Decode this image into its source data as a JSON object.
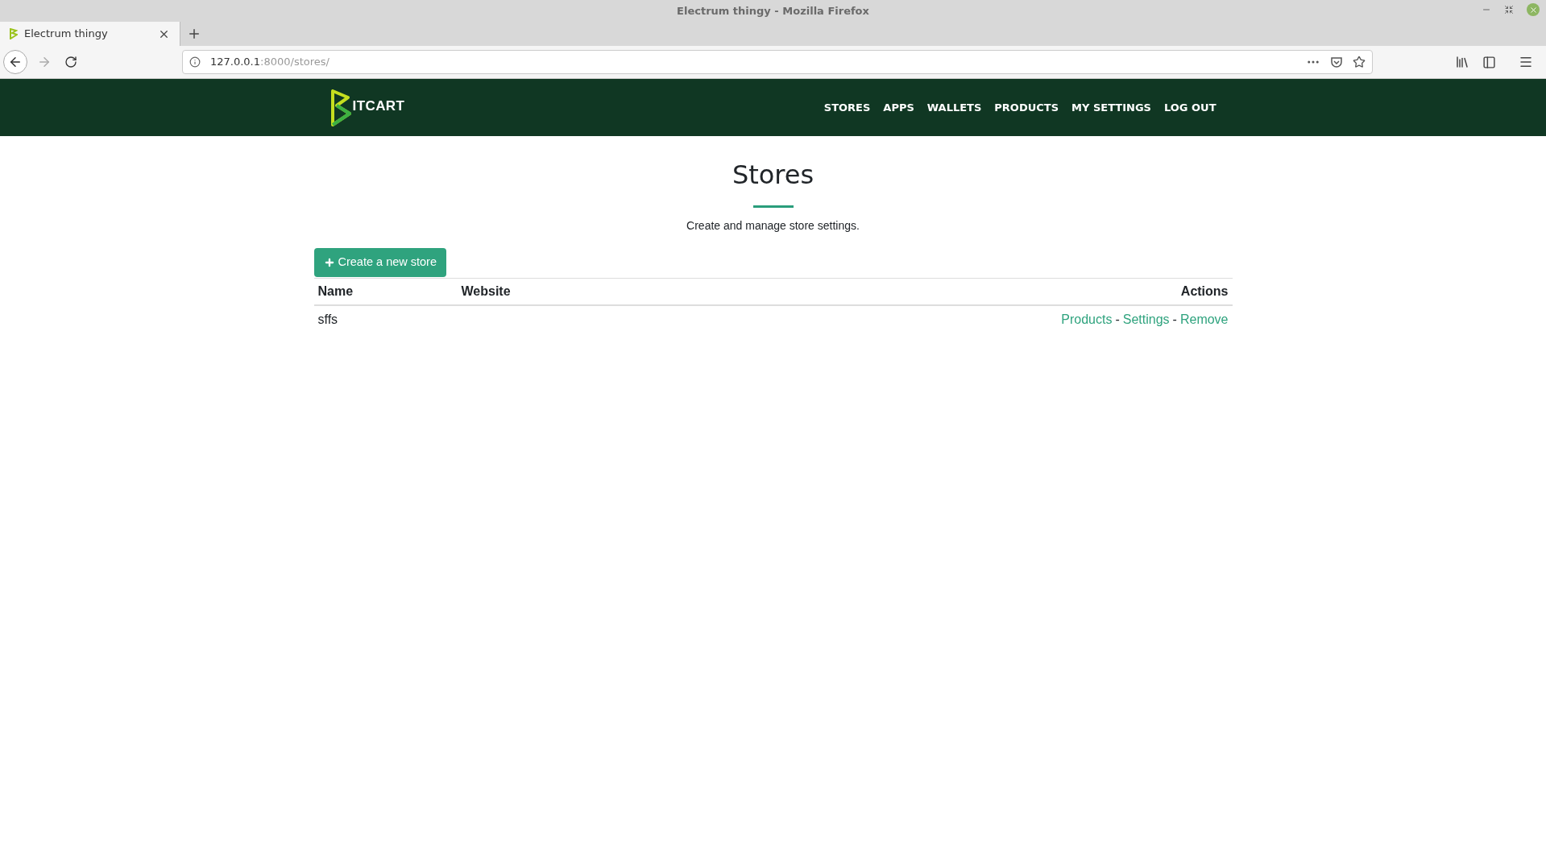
{
  "window": {
    "title": "Electrum thingy - Mozilla Firefox"
  },
  "tabs": [
    {
      "label": "Electrum thingy",
      "selected": true
    }
  ],
  "address_bar": {
    "host": "127.0.0.1",
    "rest": ":8000/stores/"
  },
  "navbar": {
    "logo_text": "ITCART",
    "links": [
      "STORES",
      "APPS",
      "WALLETS",
      "PRODUCTS",
      "MY SETTINGS",
      "LOG OUT"
    ]
  },
  "page": {
    "title": "Stores",
    "subtitle": "Create and manage store settings.",
    "create_button": "Create a new store"
  },
  "table": {
    "columns": [
      "Name",
      "Website",
      "Actions"
    ],
    "rows": [
      {
        "name": "sffs",
        "website": "",
        "actions": [
          {
            "kind": "link",
            "label": "Products"
          },
          {
            "kind": "separator",
            "label": "-"
          },
          {
            "kind": "link",
            "label": "Settings"
          },
          {
            "kind": "separator",
            "label": "-"
          },
          {
            "kind": "link",
            "label": "Remove"
          }
        ]
      }
    ]
  }
}
